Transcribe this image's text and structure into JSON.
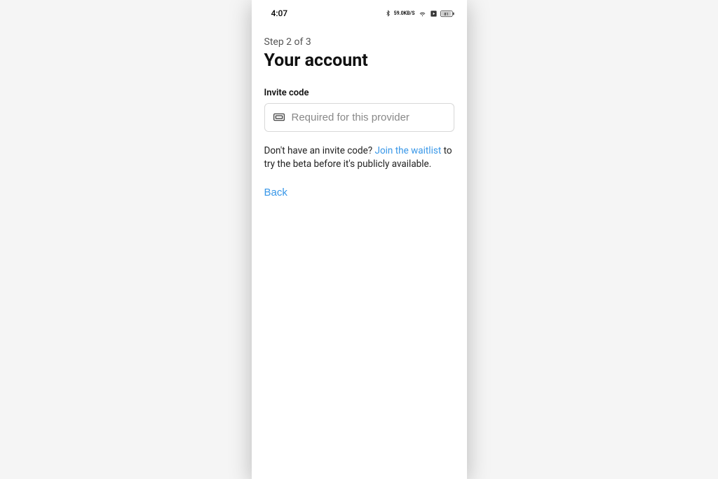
{
  "statusbar": {
    "time": "4:07",
    "net_speed_top": "59.0",
    "net_speed_bottom": "KB/S"
  },
  "step_label": "Step 2 of 3",
  "title": "Your account",
  "invite": {
    "label": "Invite code",
    "placeholder": "Required for this provider"
  },
  "helper": {
    "prefix": "Don't have an invite code? ",
    "link": "Join the waitlist",
    "suffix": " to try the beta before it's publicly available."
  },
  "back_label": "Back",
  "colors": {
    "link": "#3897e8"
  }
}
